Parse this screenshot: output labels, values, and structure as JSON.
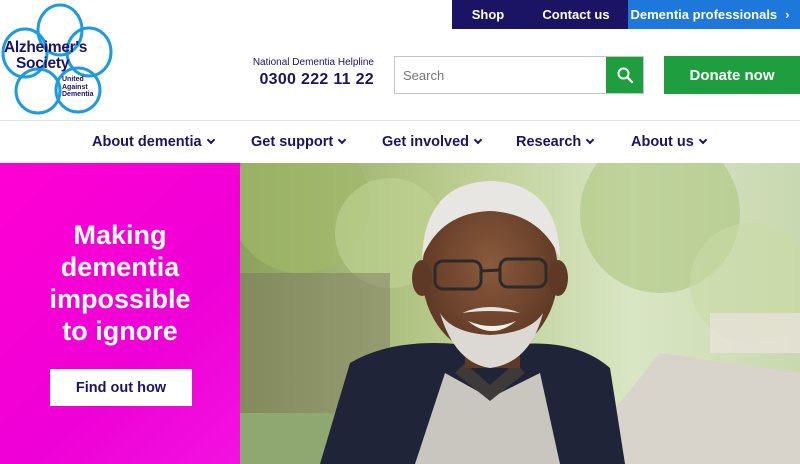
{
  "brand": {
    "name_line1": "Alzheimer's",
    "name_line2": "Society",
    "tagline": [
      "United",
      "Against",
      "Dementia"
    ]
  },
  "utility_nav": {
    "shop": "Shop",
    "contact": "Contact us",
    "professionals": "Dementia professionals"
  },
  "helpline": {
    "label": "National Dementia Helpline",
    "number": "0300 222 11 22"
  },
  "search": {
    "placeholder": "Search",
    "value": ""
  },
  "donate": {
    "label": "Donate now"
  },
  "main_nav": {
    "items": [
      {
        "label": "About dementia"
      },
      {
        "label": "Get support"
      },
      {
        "label": "Get involved"
      },
      {
        "label": "Research"
      },
      {
        "label": "About us"
      }
    ]
  },
  "hero": {
    "heading": [
      "Making",
      "dementia",
      "impossible",
      "to ignore"
    ],
    "cta_label": "Find out how"
  },
  "colors": {
    "navy": "#1b1464",
    "blue": "#1e78dc",
    "green": "#1e9e3e",
    "magenta": "#ff00d4"
  },
  "icons": {
    "search": "search-icon",
    "chevron": "chevron-right-icon",
    "caret": "chevron-down-icon"
  }
}
